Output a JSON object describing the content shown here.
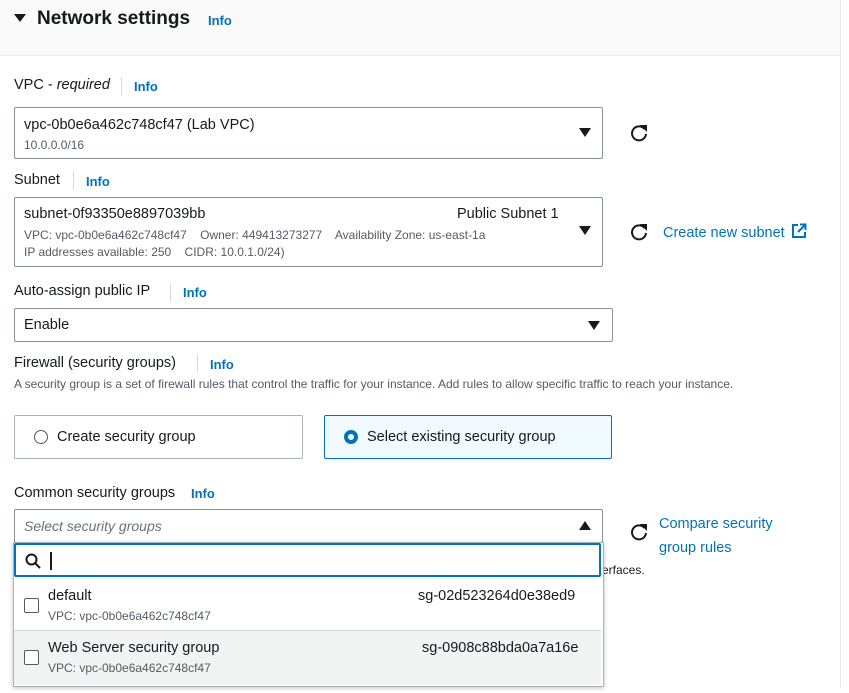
{
  "section": {
    "title": "Network settings",
    "info": "Info"
  },
  "vpc": {
    "label": "VPC - ",
    "label_req": "required",
    "info": "Info",
    "value": "vpc-0b0e6a462c748cf47 (Lab VPC)",
    "cidr": "10.0.0.0/16"
  },
  "subnet": {
    "label": "Subnet",
    "info": "Info",
    "value": "subnet-0f93350e8897039bb",
    "name": "Public Subnet 1",
    "detail1": "VPC: vpc-0b0e6a462c748cf47    Owner: 449413273277    Availability Zone: us-east-1a",
    "detail2": "IP addresses available: 250    CIDR: 10.0.1.0/24)",
    "create_link": "Create new subnet"
  },
  "public_ip": {
    "label": "Auto-assign public IP",
    "info": "Info",
    "value": "Enable"
  },
  "firewall": {
    "label": "Firewall (security groups)",
    "info": "Info",
    "desc": "A security group is a set of firewall rules that control the traffic for your instance. Add rules to allow specific traffic to reach your instance.",
    "option_create": "Create security group",
    "option_existing": "Select existing security group"
  },
  "common_sg": {
    "label": "Common security groups",
    "info": "Info",
    "placeholder": "Select security groups",
    "compare_link": "Compare security group rules",
    "hidden_text": "erfaces.",
    "search_value": "",
    "options": [
      {
        "name": "default",
        "id": "sg-02d523264d0e38ed9",
        "vpc": "VPC: vpc-0b0e6a462c748cf47"
      },
      {
        "name": "Web Server security group",
        "id": "sg-0908c88bda0a7a16e",
        "vpc": "VPC: vpc-0b0e6a462c748cf47"
      }
    ]
  },
  "colors": {
    "link": "#0073bb",
    "text": "#16191f",
    "muted": "#545b64"
  }
}
